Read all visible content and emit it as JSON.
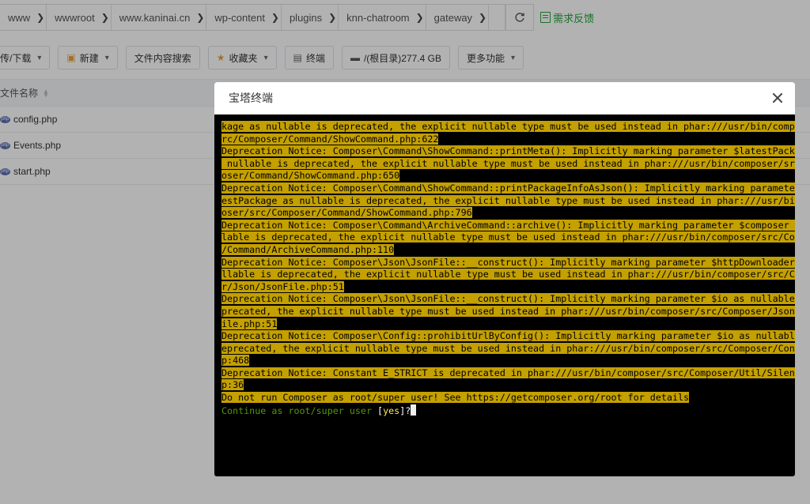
{
  "pathbar": {
    "crumbs": [
      "www",
      "wwwroot",
      "www.kaninai.cn",
      "wp-content",
      "plugins",
      "knn-chatroom",
      "gateway"
    ],
    "feedback_label": "需求反馈"
  },
  "toolbar": {
    "upload_label": "传/下载",
    "new_label": "新建",
    "search_content_label": "文件内容搜索",
    "favorites_label": "收藏夹",
    "terminal_label": "终端",
    "disk_label": "/(根目录)277.4 GB",
    "more_label": "更多功能"
  },
  "file_list": {
    "header_name": "文件名称",
    "files": [
      "config.php",
      "Events.php",
      "start.php"
    ]
  },
  "dialog": {
    "title": "宝塔终端",
    "terminal_lines": [
      {
        "text": "kage as nullable is deprecated, the explicit nullable type must be used instead in phar:///usr/bin/composer/s",
        "hl": true
      },
      {
        "text": "rc/Composer/Command/ShowCommand.php:622",
        "hl": true
      },
      {
        "text": "Deprecation Notice: Composer\\Command\\ShowCommand::printMeta(): Implicitly marking parameter $latestPackage as",
        "hl": true
      },
      {
        "text": " nullable is deprecated, the explicit nullable type must be used instead in phar:///usr/bin/composer/src/Comp",
        "hl": true
      },
      {
        "text": "oser/Command/ShowCommand.php:650",
        "hl": true
      },
      {
        "text": "Deprecation Notice: Composer\\Command\\ShowCommand::printPackageInfoAsJson(): Implicitly marking parameter $lat",
        "hl": true
      },
      {
        "text": "estPackage as nullable is deprecated, the explicit nullable type must be used instead in phar:///usr/bin/comp",
        "hl": true
      },
      {
        "text": "oser/src/Composer/Command/ShowCommand.php:796",
        "hl": true
      },
      {
        "text": "Deprecation Notice: Composer\\Command\\ArchiveCommand::archive(): Implicitly marking parameter $composer as nul",
        "hl": true
      },
      {
        "text": "lable is deprecated, the explicit nullable type must be used instead in phar:///usr/bin/composer/src/Composer",
        "hl": true
      },
      {
        "text": "/Command/ArchiveCommand.php:110",
        "hl": true
      },
      {
        "text": "Deprecation Notice: Composer\\Json\\JsonFile::__construct(): Implicitly marking parameter $httpDownloader as nu",
        "hl": true
      },
      {
        "text": "llable is deprecated, the explicit nullable type must be used instead in phar:///usr/bin/composer/src/Compose",
        "hl": true
      },
      {
        "text": "r/Json/JsonFile.php:51",
        "hl": true
      },
      {
        "text": "Deprecation Notice: Composer\\Json\\JsonFile::__construct(): Implicitly marking parameter $io as nullable is de",
        "hl": true
      },
      {
        "text": "precated, the explicit nullable type must be used instead in phar:///usr/bin/composer/src/Composer/Json/JsonF",
        "hl": true
      },
      {
        "text": "ile.php:51",
        "hl": true
      },
      {
        "text": "Deprecation Notice: Composer\\Config::prohibitUrlByConfig(): Implicitly marking parameter $io as nullable is d",
        "hl": true
      },
      {
        "text": "eprecated, the explicit nullable type must be used instead in phar:///usr/bin/composer/src/Composer/Config.ph",
        "hl": true
      },
      {
        "text": "p:468",
        "hl": true
      },
      {
        "text": "Deprecation Notice: Constant E_STRICT is deprecated in phar:///usr/bin/composer/src/Composer/Util/Silencer.ph",
        "hl": true
      },
      {
        "text": "p:36",
        "hl": true
      },
      {
        "text": "Do not run Composer as root/super user! See https://getcomposer.org/root for details",
        "hl": true
      }
    ],
    "prompt_text": "Continue as root/super user ",
    "prompt_open": "[",
    "prompt_default": "yes",
    "prompt_close": "]?"
  },
  "colors": {
    "highlight_bg": "#c4a000",
    "prompt_green": "#4e9a06",
    "default_yellow": "#fce94f",
    "feedback_green": "#20a53a"
  }
}
